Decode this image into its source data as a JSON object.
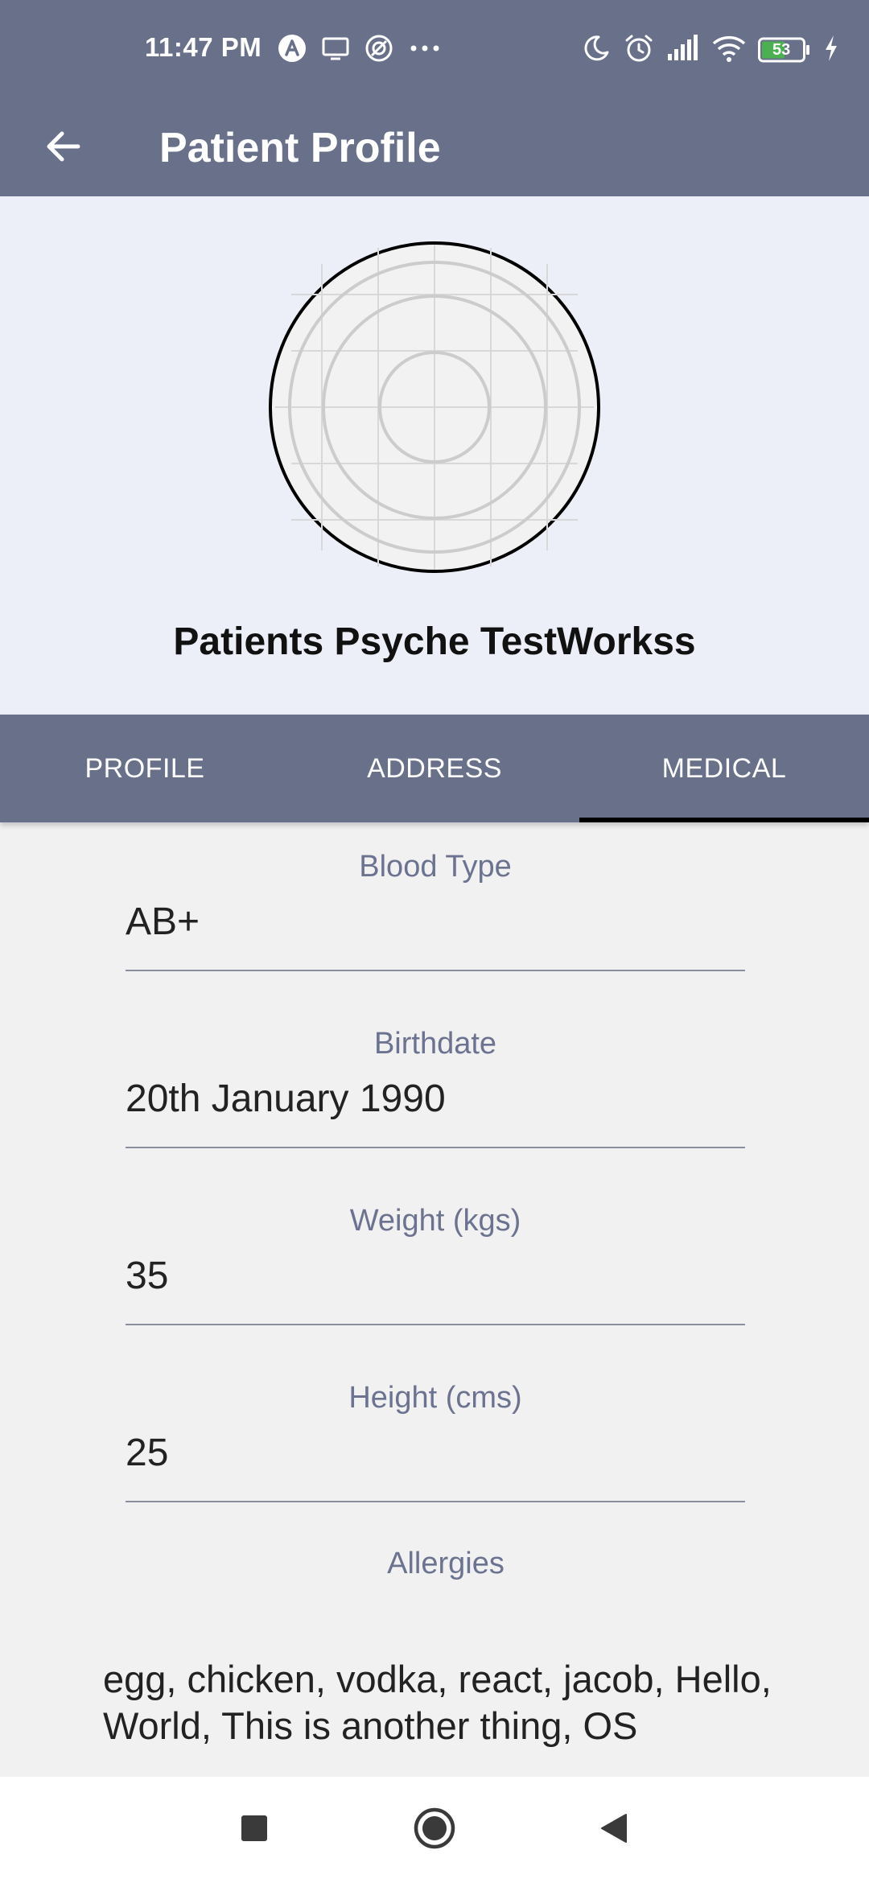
{
  "status_bar": {
    "time": "11:47 PM",
    "battery_level": "53",
    "left_icons": [
      "a-circle-icon",
      "monitor-icon",
      "sync-icon",
      "more-dots-icon"
    ],
    "right_icons": [
      "moon-icon",
      "alarm-icon",
      "signal-icon",
      "wifi-icon",
      "battery-icon",
      "charging-icon"
    ]
  },
  "app_bar": {
    "title": "Patient Profile",
    "back_icon": "arrow-left-icon"
  },
  "profile": {
    "name": "Patients Psyche TestWorkss",
    "avatar_icon": "avatar-placeholder-icon"
  },
  "tabs": [
    {
      "label": "PROFILE",
      "active": false
    },
    {
      "label": "ADDRESS",
      "active": false
    },
    {
      "label": "MEDICAL",
      "active": true
    }
  ],
  "medical": {
    "blood_type": {
      "label": "Blood Type",
      "value": "AB+"
    },
    "birthdate": {
      "label": "Birthdate",
      "value": "20th January 1990"
    },
    "weight": {
      "label": "Weight (kgs)",
      "value": "35"
    },
    "height": {
      "label": "Height (cms)",
      "value": "25"
    },
    "allergies": {
      "label": "Allergies",
      "value": "egg, chicken, vodka, react, jacob, Hello, World, This is another thing, OS"
    }
  },
  "nav_bar": {
    "icons": [
      "recents-square-icon",
      "home-circle-icon",
      "back-triangle-icon"
    ]
  },
  "colors": {
    "primary": "#68708a",
    "hero_bg": "#eceff7",
    "page_bg": "#f1f1f1",
    "label": "#6c7390",
    "battery_green": "#4caf50"
  }
}
